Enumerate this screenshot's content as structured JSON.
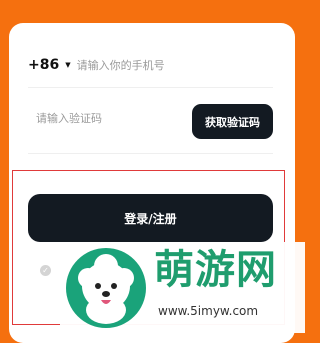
{
  "login": {
    "country_code": "+86",
    "phone_placeholder": "请输入你的手机号",
    "code_placeholder": "请输入验证码",
    "get_code_label": "获取验证码",
    "submit_label": "登录/注册"
  },
  "watermark": {
    "title": "萌游网",
    "url": "www.5imyw.com"
  },
  "colors": {
    "background": "#f5700f",
    "button": "#131a22",
    "watermark_green": "#1f9d6e",
    "highlight_border": "#e03a3a"
  }
}
